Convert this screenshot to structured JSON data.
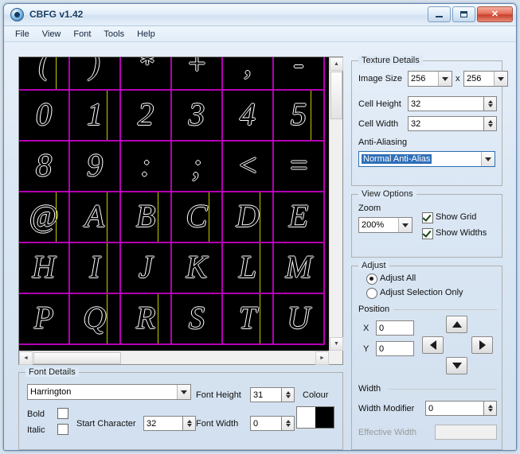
{
  "window": {
    "title": "CBFG v1.42",
    "icon": "app-icon",
    "buttons": {
      "minimize": "minimize-icon",
      "maximize": "maximize-icon",
      "close": "✕"
    }
  },
  "menu": [
    "File",
    "View",
    "Font",
    "Tools",
    "Help"
  ],
  "preview": {
    "rows": [
      [
        {
          "ch": "(",
          "w": true
        },
        {
          "ch": ")",
          "w": false
        },
        {
          "ch": "*",
          "w": false
        },
        {
          "ch": "+",
          "w": false
        },
        {
          "ch": ",",
          "w": false
        },
        {
          "ch": "-",
          "w": false
        }
      ],
      [
        {
          "ch": "0",
          "w": false
        },
        {
          "ch": "1",
          "w": true
        },
        {
          "ch": "2",
          "w": false
        },
        {
          "ch": "3",
          "w": false
        },
        {
          "ch": "4",
          "w": false
        },
        {
          "ch": "5",
          "w": true
        }
      ],
      [
        {
          "ch": "8",
          "w": false
        },
        {
          "ch": "9",
          "w": false
        },
        {
          "ch": ":",
          "w": false
        },
        {
          "ch": ";",
          "w": false
        },
        {
          "ch": "<",
          "w": false
        },
        {
          "ch": "=",
          "w": false
        }
      ],
      [
        {
          "ch": "@",
          "w": true
        },
        {
          "ch": "A",
          "w": true
        },
        {
          "ch": "B",
          "w": true
        },
        {
          "ch": "C",
          "w": true
        },
        {
          "ch": "D",
          "w": true
        },
        {
          "ch": "E",
          "w": false
        }
      ],
      [
        {
          "ch": "H",
          "w": false
        },
        {
          "ch": "I",
          "w": true
        },
        {
          "ch": "J",
          "w": false
        },
        {
          "ch": "K",
          "w": false
        },
        {
          "ch": "L",
          "w": true
        },
        {
          "ch": "M",
          "w": false
        }
      ],
      [
        {
          "ch": "P",
          "w": false
        },
        {
          "ch": "Q",
          "w": true
        },
        {
          "ch": "R",
          "w": true
        },
        {
          "ch": "S",
          "w": false
        },
        {
          "ch": "T",
          "w": true
        },
        {
          "ch": "U",
          "w": false
        }
      ]
    ],
    "grid_color": "#b500b5",
    "width_color": "#c8c800",
    "background": "#000000"
  },
  "texture_details": {
    "legend": "Texture Details",
    "image_size_label": "Image Size",
    "image_size_w": "256",
    "image_size_x": "x",
    "image_size_h": "256",
    "cell_height_label": "Cell Height",
    "cell_height": "32",
    "cell_width_label": "Cell Width",
    "cell_width": "32",
    "anti_aliasing_label": "Anti-Aliasing",
    "anti_aliasing": "Normal Anti-Alias"
  },
  "view_options": {
    "legend": "View Options",
    "zoom_label": "Zoom",
    "zoom": "200%",
    "show_grid": "Show Grid",
    "show_widths": "Show Widths",
    "show_grid_checked": true,
    "show_widths_checked": true
  },
  "adjust": {
    "legend": "Adjust",
    "adjust_all": "Adjust All",
    "adjust_selection_only": "Adjust Selection Only",
    "mode": "all",
    "position_label": "Position",
    "x_label": "X",
    "x_value": "0",
    "y_label": "Y",
    "y_value": "0",
    "width_label": "Width",
    "width_modifier_label": "Width Modifier",
    "width_modifier": "0",
    "effective_width_label": "Effective Width",
    "effective_width": ""
  },
  "font_details": {
    "legend": "Font Details",
    "font_name": "Harrington",
    "bold_label": "Bold",
    "italic_label": "Italic",
    "bold_checked": false,
    "italic_checked": false,
    "start_character_label": "Start Character",
    "start_character": "32",
    "font_height_label": "Font Height",
    "font_height": "31",
    "font_width_label": "Font Width",
    "font_width": "0",
    "colour_label": "Colour",
    "colour_fg": "#ffffff",
    "colour_bg": "#000000"
  }
}
